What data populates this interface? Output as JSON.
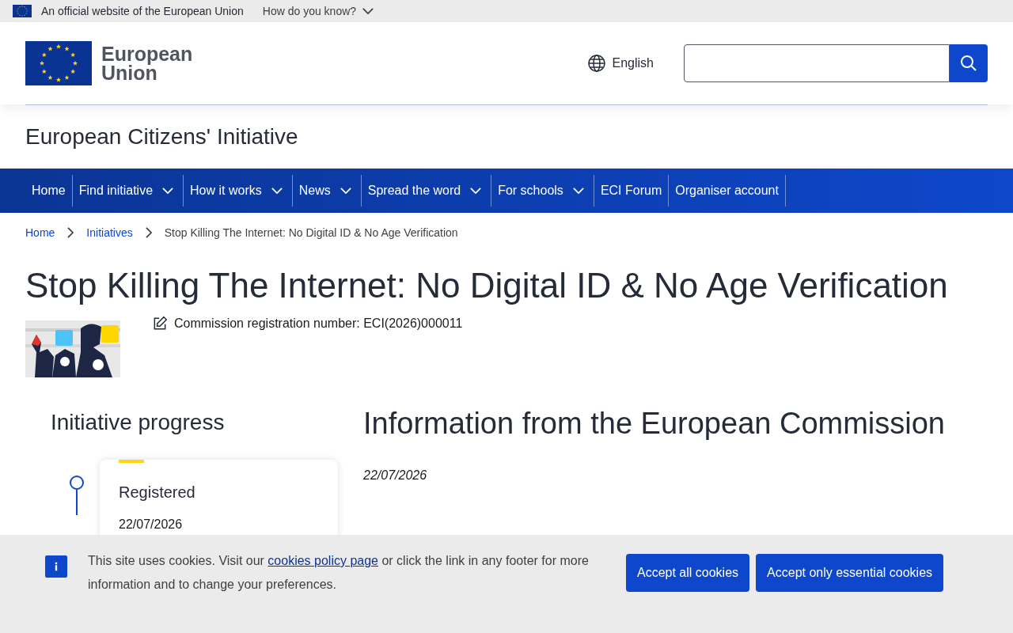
{
  "official_bar": {
    "text": "An official website of the European Union",
    "link": "How do you know?"
  },
  "header": {
    "logo_line_1": "European",
    "logo_line_2": "Union",
    "language": "English"
  },
  "site_name": "European Citizens' Initiative",
  "nav": [
    {
      "label": "Home",
      "dropdown": false
    },
    {
      "label": "Find initiative",
      "dropdown": true
    },
    {
      "label": "How it works",
      "dropdown": true
    },
    {
      "label": "News",
      "dropdown": true
    },
    {
      "label": "Spread the word",
      "dropdown": true
    },
    {
      "label": "For schools",
      "dropdown": true
    },
    {
      "label": "ECI Forum",
      "dropdown": false
    },
    {
      "label": "Organiser account",
      "dropdown": false
    }
  ],
  "breadcrumb": [
    "Home",
    "Initiatives",
    "Stop Killing The Internet: No Digital ID & No Age Verification"
  ],
  "title": "Stop Killing The Internet: No Digital ID & No Age Verification",
  "registration": "Commission registration number: ECI(2026)000011",
  "progress": {
    "title": "Initiative progress",
    "steps": [
      {
        "name": "Registered",
        "date": "22/07/2026"
      }
    ]
  },
  "information": {
    "title": "Information from the European Commission",
    "date": "22/07/2026"
  },
  "cookie": {
    "before": "This site uses cookies. Visit our ",
    "link": "cookies policy page",
    "after": " or click the link in any footer for more information and to change your preferences.",
    "buttons": [
      "Accept all cookies",
      "Accept only essential cookies"
    ]
  }
}
